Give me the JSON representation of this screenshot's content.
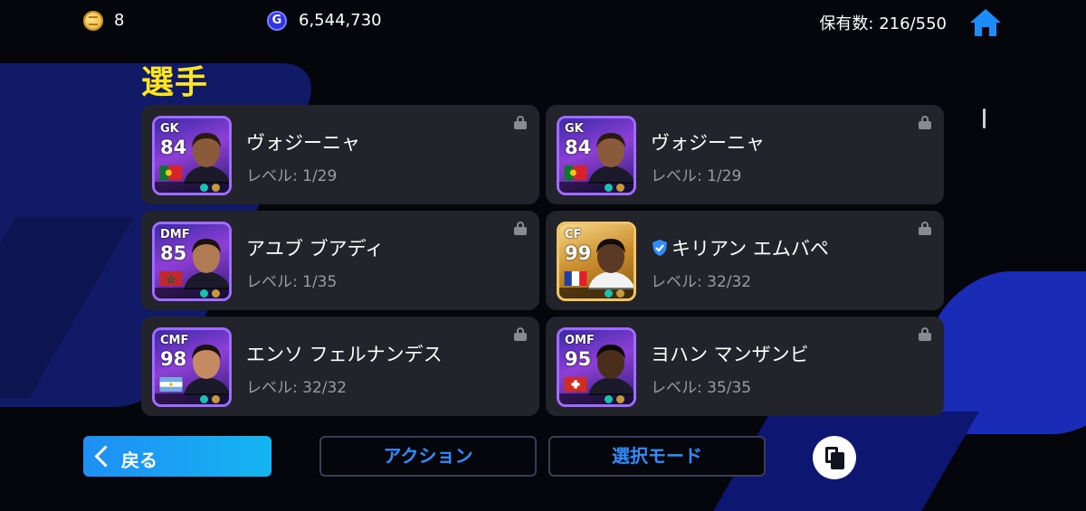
{
  "topbar": {
    "coins": "8",
    "gp": "6,544,730",
    "owned_label": "保有数: 216/550"
  },
  "title": "選手",
  "players": [
    {
      "position": "GK",
      "rating": "84",
      "name": "ヴォジーニャ",
      "level": "レベル: 1/29",
      "style": "purple",
      "flag": "portugal",
      "verified": false
    },
    {
      "position": "GK",
      "rating": "84",
      "name": "ヴォジーニャ",
      "level": "レベル: 1/29",
      "style": "purple",
      "flag": "portugal",
      "verified": false
    },
    {
      "position": "DMF",
      "rating": "85",
      "name": "アユブ ブアディ",
      "level": "レベル: 1/35",
      "style": "purple",
      "flag": "morocco",
      "verified": false
    },
    {
      "position": "CF",
      "rating": "99",
      "name": "キリアン エムバペ",
      "level": "レベル: 32/32",
      "style": "gold",
      "flag": "france",
      "verified": true
    },
    {
      "position": "CMF",
      "rating": "98",
      "name": "エンソ フェルナンデス",
      "level": "レベル: 32/32",
      "style": "purple",
      "flag": "argentina",
      "verified": false
    },
    {
      "position": "OMF",
      "rating": "95",
      "name": "ヨハン マンザンビ",
      "level": "レベル: 35/35",
      "style": "purple",
      "flag": "switzerland",
      "verified": false
    }
  ],
  "bottombar": {
    "back_label": "戻る",
    "action_label": "アクション",
    "select_mode_label": "選択モード"
  },
  "icons": [
    "coin-icon",
    "gp-icon",
    "home-icon",
    "lock-icon",
    "verified-check-icon",
    "back-chevron-icon",
    "copy-icon"
  ],
  "colors": {
    "title": "#ffe51c",
    "accent": "#1e8ff5",
    "card_bg": "#23232b",
    "button_text": "#2f8dff"
  }
}
